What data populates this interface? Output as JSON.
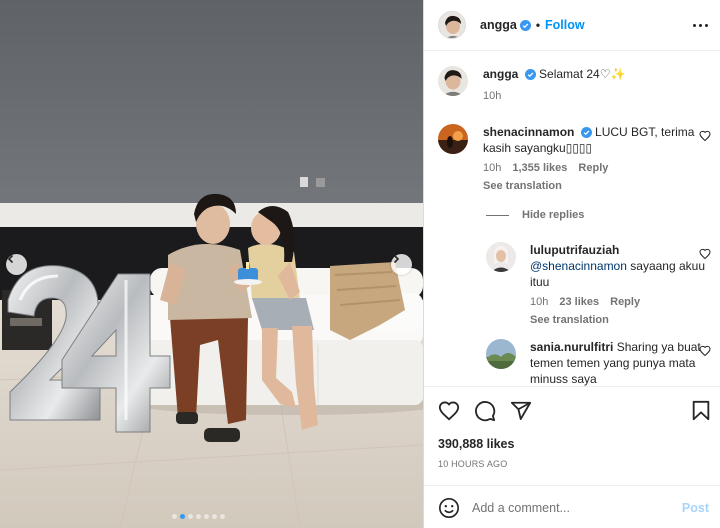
{
  "post": {
    "username": "angga",
    "separator": "•",
    "follow_label": "Follow",
    "caption_user": "angga",
    "caption_text": "Selamat 24♡✨",
    "caption_time": "10h"
  },
  "comments": [
    {
      "user": "shenacinnamon",
      "verified": true,
      "text": "LUCU BGT, terima kasih sayangku▯▯▯▯",
      "time": "10h",
      "likes": "1,355 likes",
      "reply": "Reply",
      "translation": "See translation"
    }
  ],
  "hide_replies_label": "Hide replies",
  "replies": [
    {
      "user": "luluputrifauziah",
      "mention": "@shenacinnamon",
      "text": "sayaang akuu ituu",
      "time": "10h",
      "likes": "23 likes",
      "reply": "Reply",
      "translation": "See translation"
    },
    {
      "user": "sania.nurulfitri",
      "text": "Sharing ya buat temen temen yang punya mata minuss saya"
    }
  ],
  "likes_count": "390,888 likes",
  "posted_ago": "10 HOURS AGO",
  "comment_input": {
    "placeholder": "Add a comment...",
    "post_label": "Post"
  },
  "colors": {
    "accent": "#0095f6",
    "verified": "#3897f0",
    "muted": "#737373"
  },
  "icons": [
    "heart-icon",
    "comment-icon",
    "share-icon",
    "save-icon",
    "emoji-icon",
    "more-options-icon",
    "chevron-left-icon",
    "chevron-right-icon"
  ]
}
